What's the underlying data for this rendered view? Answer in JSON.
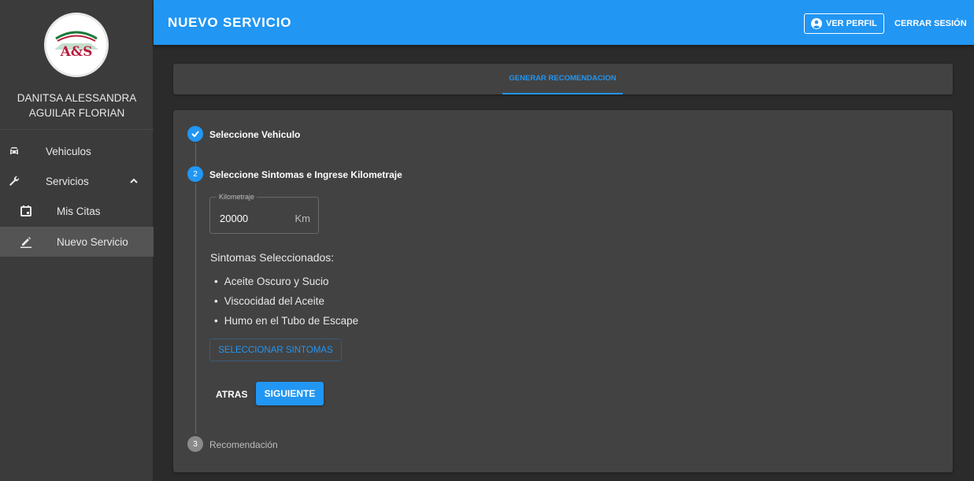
{
  "sidebar": {
    "logo_text": "A&S",
    "user_name_line1": "DANITSA ALESSANDRA",
    "user_name_line2": "AGUILAR FLORIAN",
    "items": [
      {
        "label": "Vehiculos",
        "icon": "car-icon"
      },
      {
        "label": "Servicios",
        "icon": "wrench-icon",
        "expanded": true
      },
      {
        "label": "Mis Citas",
        "icon": "calendar-icon"
      },
      {
        "label": "Nuevo Servicio",
        "icon": "pencil-icon",
        "active": true
      }
    ]
  },
  "header": {
    "title": "NUEVO SERVICIO",
    "profile_button": "VER PERFIL",
    "logout_button": "CERRAR SESIÓN"
  },
  "tabs": [
    {
      "label": "GENERAR RECOMENDACION",
      "active": true
    }
  ],
  "stepper": {
    "steps": [
      {
        "number": "1",
        "label": "Seleccione Vehiculo",
        "state": "completed"
      },
      {
        "number": "2",
        "label": "Seleccione Sintomas e Ingrese Kilometraje",
        "state": "active"
      },
      {
        "number": "3",
        "label": "Recomendación",
        "state": "pending"
      }
    ],
    "km_field": {
      "label": "Kilometraje",
      "value": "20000",
      "unit": "Km"
    },
    "symptoms_title": "Sintomas Seleccionados:",
    "symptoms": [
      "Aceite Oscuro y Sucio",
      "Viscocidad del Aceite",
      "Humo en el Tubo de Escape"
    ],
    "select_button": "SELECCIONAR SINTOMAS",
    "back_button": "ATRAS",
    "next_button": "SIGUIENTE"
  },
  "colors": {
    "primary": "#2196f3",
    "sidebar_bg": "#3b3b3b",
    "card_bg": "#424242",
    "page_bg": "#2b2b2b",
    "logo_red": "#b71c3c",
    "logo_green": "#1b7a3a"
  }
}
